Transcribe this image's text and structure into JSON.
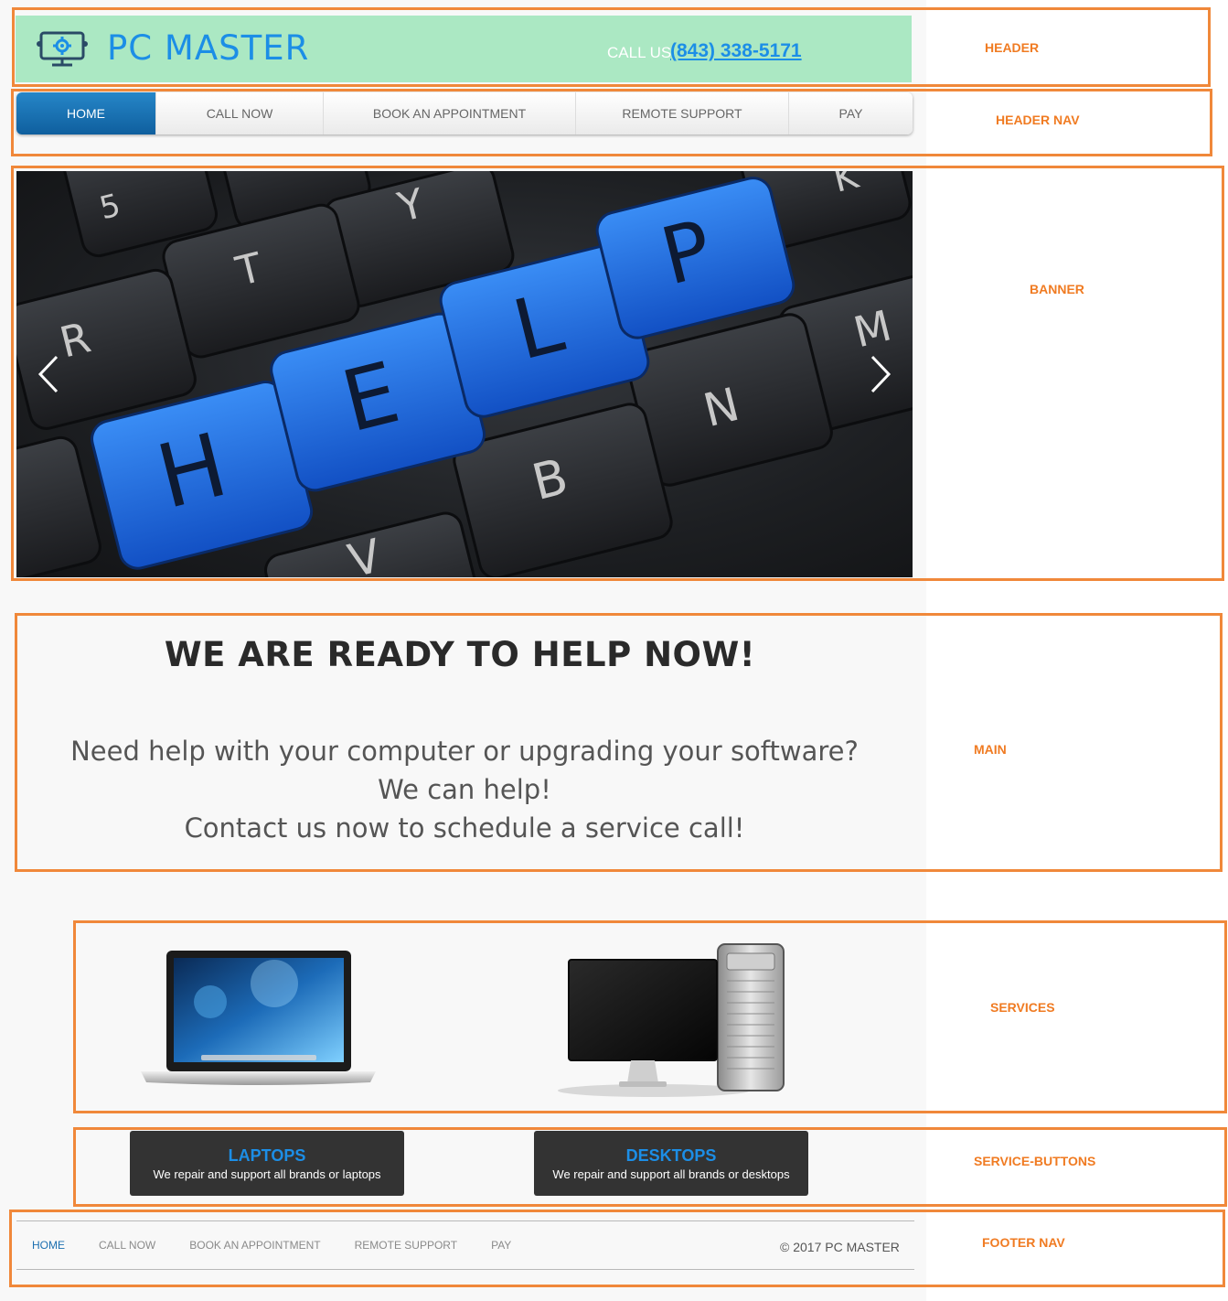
{
  "header": {
    "logo_text": "PC MASTER",
    "call_us_label": "CALL US",
    "phone": "(843) 338-5171"
  },
  "nav": {
    "items": [
      {
        "label": "HOME",
        "active": true
      },
      {
        "label": "CALL NOW"
      },
      {
        "label": "BOOK AN APPOINTMENT"
      },
      {
        "label": "REMOTE SUPPORT"
      },
      {
        "label": "PAY"
      }
    ]
  },
  "banner": {
    "keys": [
      "5",
      "T",
      "Y",
      "K",
      "R",
      "M",
      "N",
      "B",
      "V"
    ],
    "help_keys": [
      "H",
      "E",
      "L",
      "P"
    ]
  },
  "main": {
    "title": "WE ARE READY TO HELP NOW!",
    "lines": [
      "Need help with your computer or upgrading your software?",
      "We can help!",
      "Contact us now to schedule a service call!"
    ]
  },
  "services": {
    "buttons": [
      {
        "title": "LAPTOPS",
        "subtitle": "We repair and support all brands or laptops"
      },
      {
        "title": "DESKTOPS",
        "subtitle": "We repair and support all brands or desktops"
      }
    ]
  },
  "footer": {
    "nav": [
      "HOME",
      "CALL NOW",
      "BOOK AN APPOINTMENT",
      "REMOTE SUPPORT",
      "PAY"
    ],
    "copyright": "© 2017 PC MASTER"
  },
  "annotations": {
    "header": "HEADER",
    "header_nav": "HEADER NAV",
    "banner": "BANNER",
    "main": "MAIN",
    "services": "SERVICES",
    "service_buttons": "SERVICE-BUTTONS",
    "footer_nav": "FOOTER NAV"
  },
  "colors": {
    "accent": "#1c8ee6",
    "header_bg": "#abe8c3",
    "annotation": "#f0883a",
    "help_key": "#1f6fe0"
  },
  "icons": [
    "monitor-gear-logo-icon",
    "chevron-left-icon",
    "chevron-right-icon"
  ]
}
